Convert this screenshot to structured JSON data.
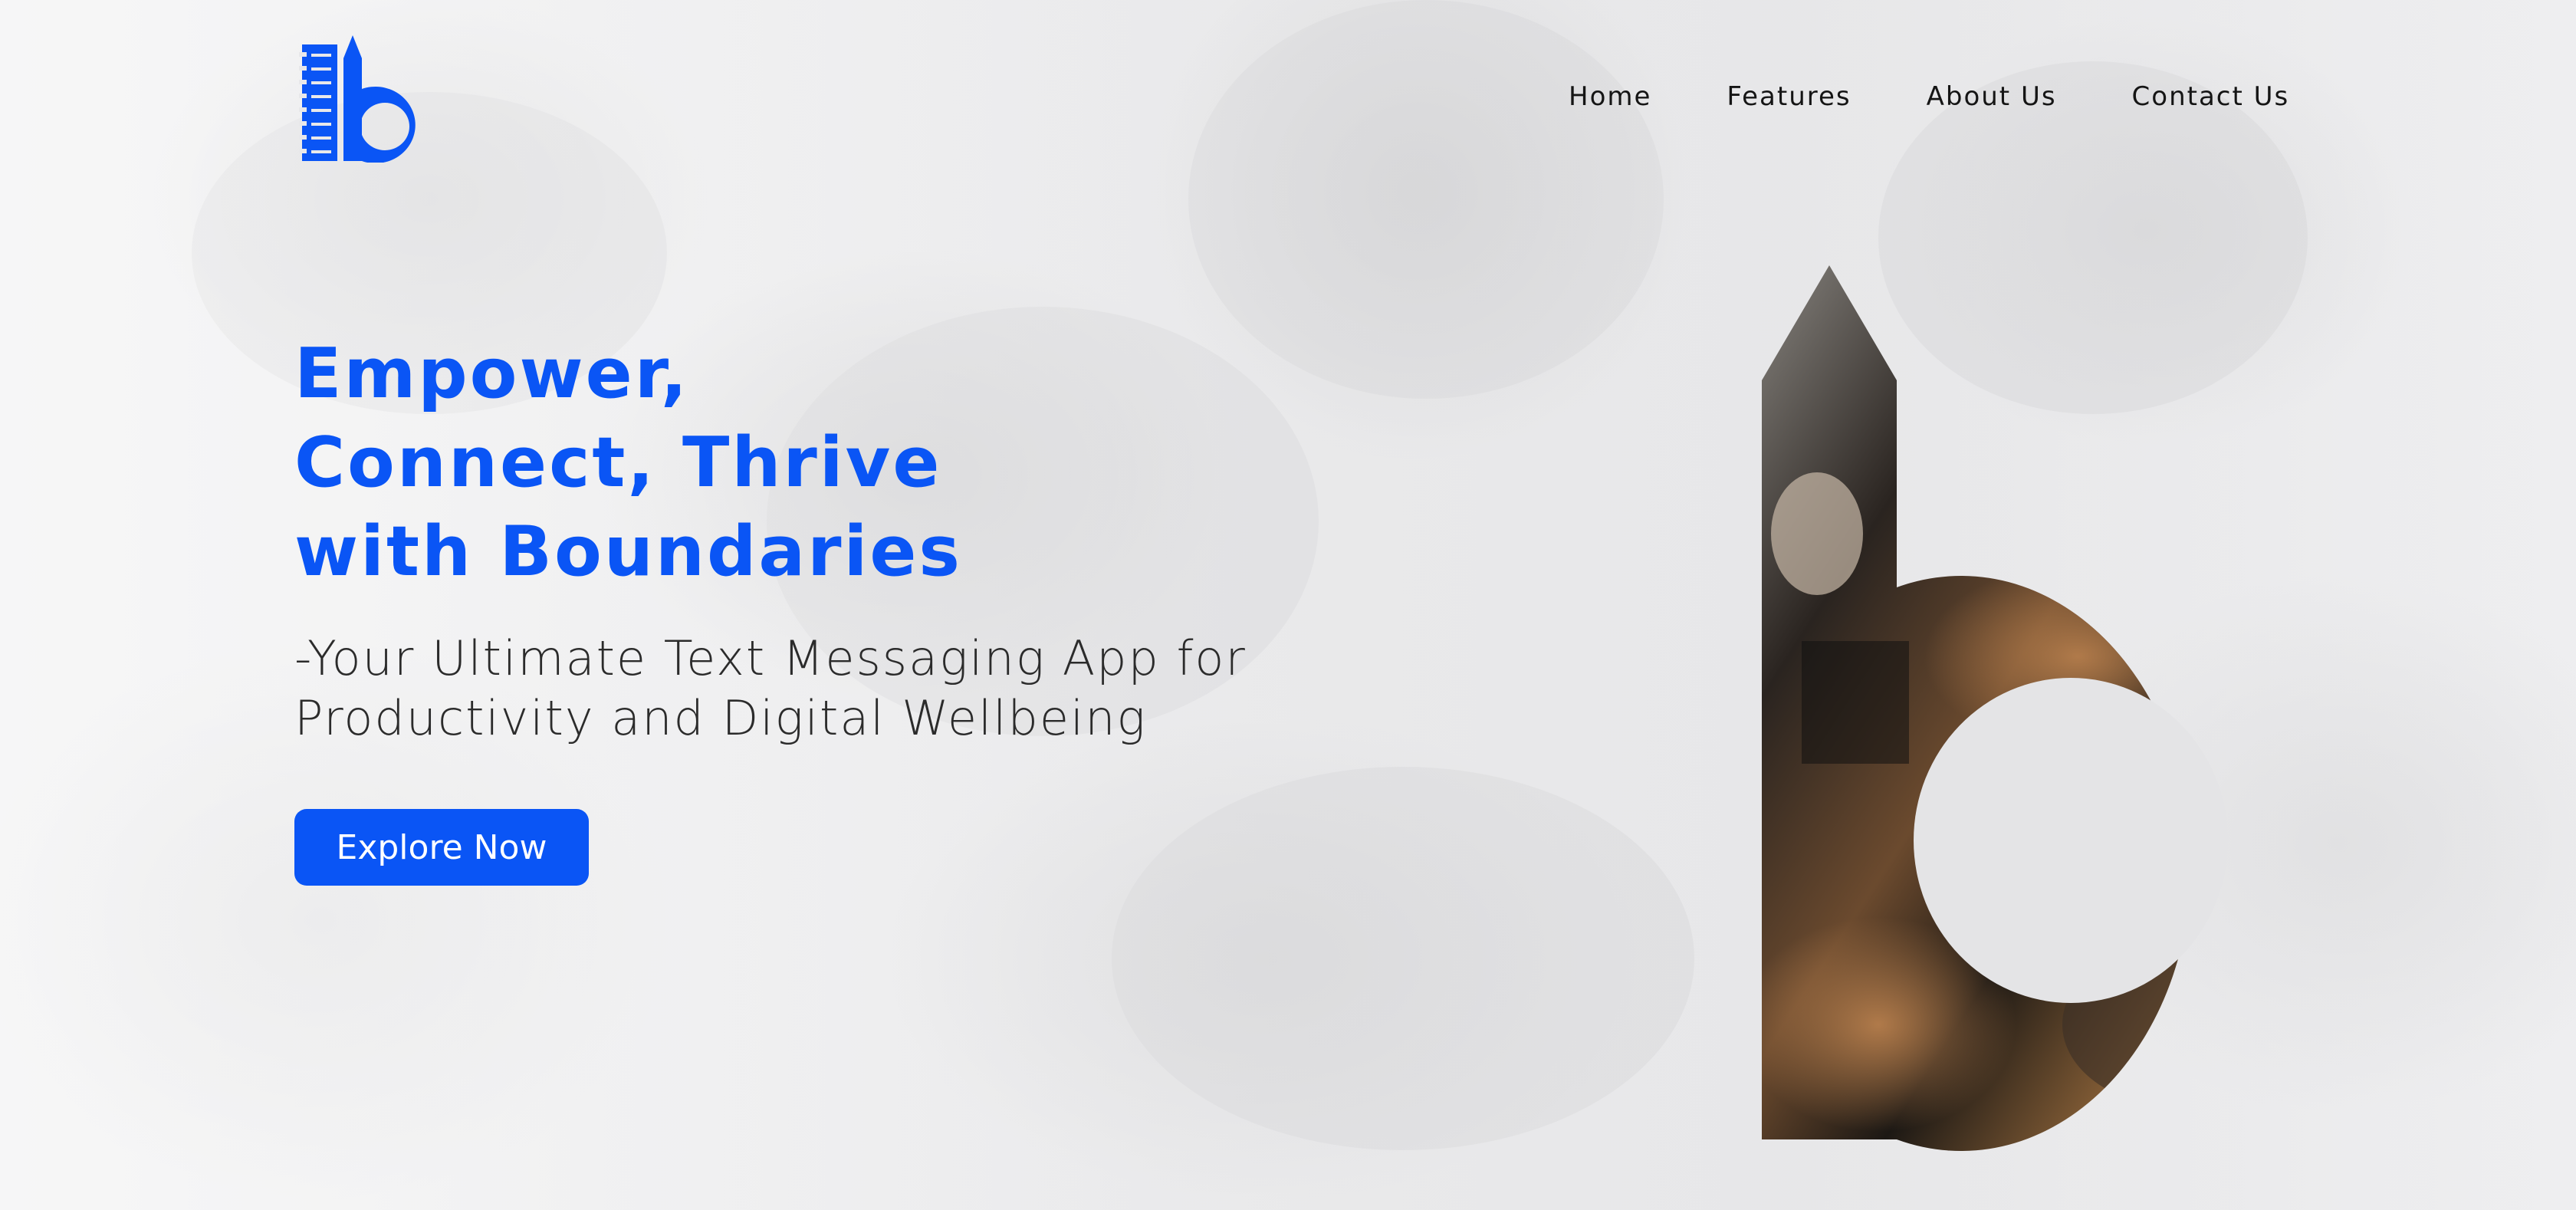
{
  "brand": {
    "logo": "ib-pencil-logo",
    "accent_color": "#0A55F5"
  },
  "nav": {
    "items": [
      {
        "label": "Home"
      },
      {
        "label": "Features"
      },
      {
        "label": "About Us"
      },
      {
        "label": "Contact Us"
      }
    ]
  },
  "hero": {
    "title_lines": [
      "Empower,",
      "Connect, Thrive",
      "with Boundaries"
    ],
    "subtitle_lines": [
      "-Your Ultimate Text Messaging App for",
      "Productivity and Digital Wellbeing"
    ],
    "cta_label": "Explore Now"
  },
  "illustration": {
    "icon": "letter-b-photo-icon"
  }
}
